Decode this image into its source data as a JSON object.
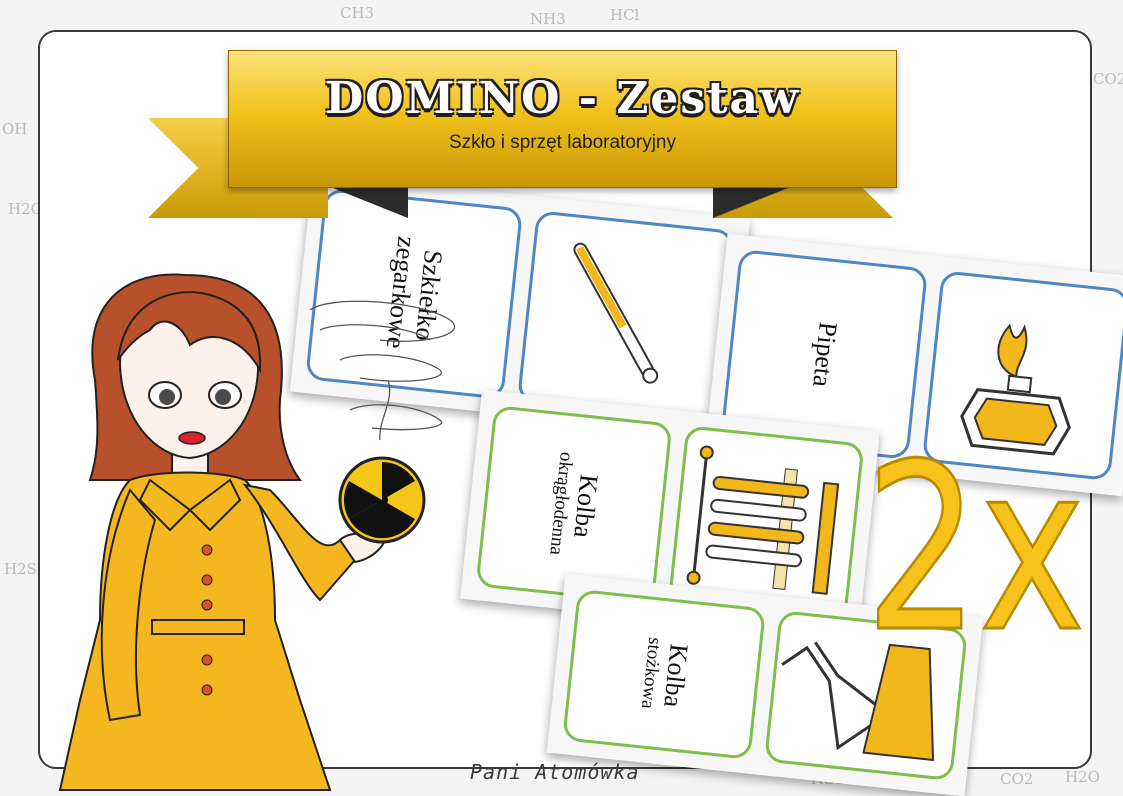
{
  "banner": {
    "title": "DOMINO - Zestaw",
    "subtitle": "Szkło i sprzęt laboratoryjny"
  },
  "cards": [
    {
      "color": "blue",
      "top_text": "Szkiełko",
      "bottom_text": "zegarkowe",
      "icon": "thermometer-icon"
    },
    {
      "color": "blue",
      "top_text": "Pipeta",
      "bottom_text": "",
      "icon": "burner-icon"
    },
    {
      "color": "green",
      "top_text": "Kolba",
      "bottom_text": "okrągłodenna",
      "icon": "test-tube-rack-icon"
    },
    {
      "color": "green",
      "top_text": "Kolba",
      "bottom_text": "stożkowa",
      "icon": "flask-icon"
    }
  ],
  "multiplier": "2x",
  "author": "Pani Atomówka",
  "background_formulas": [
    "CH3",
    "NH3",
    "HCl",
    "OH",
    "H2O",
    "H2S",
    "CO2",
    "NaOH",
    "CO2",
    "H2O"
  ],
  "colors": {
    "accent": "#f7c21a",
    "blue_frame": "#4f86c6",
    "green_frame": "#7dbf4a"
  }
}
